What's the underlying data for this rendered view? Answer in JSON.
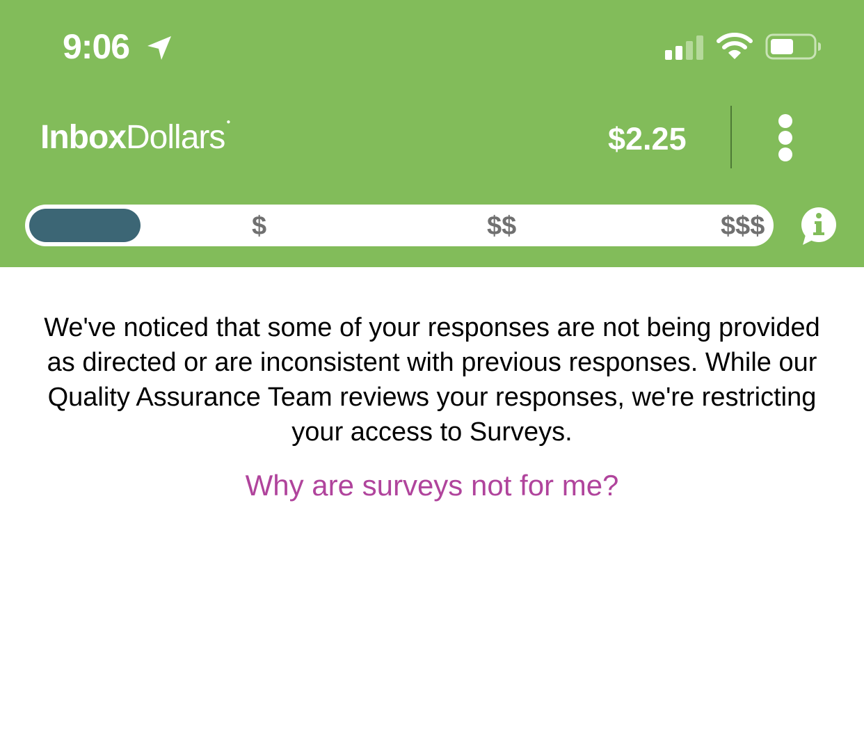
{
  "status_bar": {
    "time": "9:06",
    "icons": [
      "location-arrow-icon",
      "cellular-signal-icon",
      "wifi-icon",
      "battery-icon"
    ]
  },
  "app_bar": {
    "brand_bold": "Inbox",
    "brand_light": "Dollars",
    "balance": "$2.25",
    "menu_icon": "more-vertical-icon"
  },
  "tier_selector": {
    "labels": [
      "$",
      "$$",
      "$$$"
    ],
    "selected_fraction": 0.15,
    "info_icon": "info-bubble-icon"
  },
  "content": {
    "message": "We've noticed that some of your responses are not being provided as directed or are inconsistent with previous responses. While our Quality Assurance Team reviews your responses, we're restricting your access to Surveys.",
    "link": "Why are surveys not for me?"
  },
  "colors": {
    "header_bg": "#82bc5a",
    "tier_fill": "#3c6675",
    "link": "#b0449c",
    "tier_label": "#707070"
  }
}
